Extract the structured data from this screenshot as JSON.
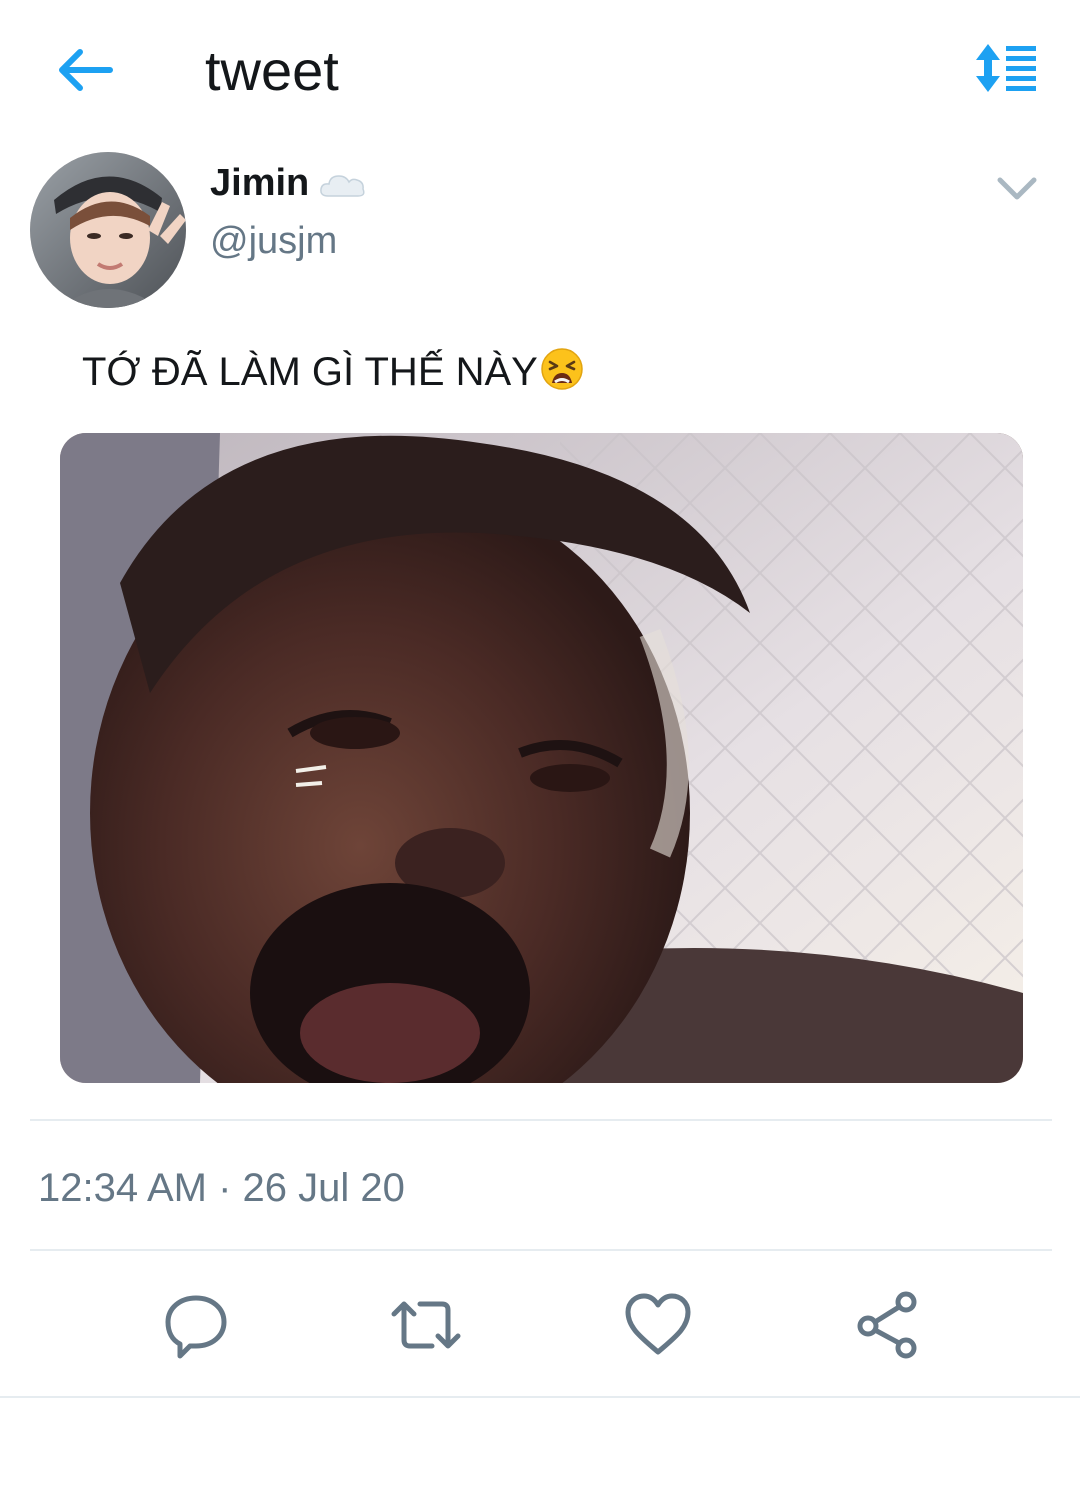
{
  "header": {
    "title": "tweet",
    "back_icon": "arrow-left-icon",
    "sort_icon": "sort-timeline-icon",
    "accent_color": "#1da1f2"
  },
  "tweet": {
    "author": {
      "display_name": "Jimin",
      "name_emoji_icon": "cloud-icon",
      "handle": "@jusjm"
    },
    "menu_icon": "chevron-down-icon",
    "text": "TỚ ĐÃ LÀM GÌ THẾ NÀY",
    "text_emoji_icon": "tired-face-emoji",
    "media_icon": "photo",
    "timestamp": "12:34 AM · 26 Jul 20"
  },
  "actions": [
    {
      "name": "reply-button",
      "icon": "reply-icon"
    },
    {
      "name": "retweet-button",
      "icon": "retweet-icon"
    },
    {
      "name": "like-button",
      "icon": "heart-icon"
    },
    {
      "name": "share-button",
      "icon": "share-icon"
    }
  ],
  "colors": {
    "text": "#14171a",
    "secondary": "#657786",
    "divider": "#e6ecf0",
    "icon": "#657786"
  }
}
